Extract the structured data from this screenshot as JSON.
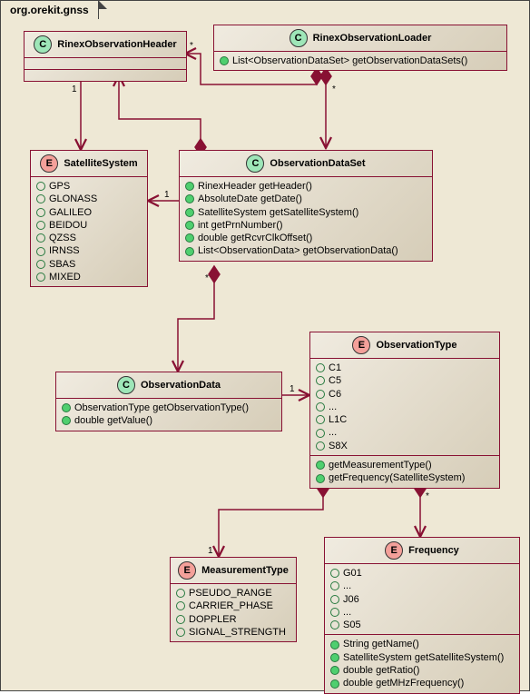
{
  "package": {
    "name": "org.orekit.gnss"
  },
  "nodes": {
    "rinexHeader": {
      "stereo": "C",
      "name": "RinexObservationHeader",
      "comp1": [],
      "comp2": []
    },
    "rinexLoader": {
      "stereo": "C",
      "name": "RinexObservationLoader",
      "methods": [
        "List<ObservationDataSet> getObservationDataSets()"
      ]
    },
    "satSystem": {
      "stereo": "E",
      "name": "SatelliteSystem",
      "values": [
        "GPS",
        "GLONASS",
        "GALILEO",
        "BEIDOU",
        "QZSS",
        "IRNSS",
        "SBAS",
        "MIXED"
      ]
    },
    "obsDataSet": {
      "stereo": "C",
      "name": "ObservationDataSet",
      "methods": [
        "RinexHeader getHeader()",
        "AbsoluteDate getDate()",
        "SatelliteSystem getSatelliteSystem()",
        "int getPrnNumber()",
        "double getRcvrClkOffset()",
        "List<ObservationData> getObservationData()"
      ]
    },
    "obsData": {
      "stereo": "C",
      "name": "ObservationData",
      "methods": [
        "ObservationType getObservationType()",
        "double getValue()"
      ]
    },
    "obsType": {
      "stereo": "E",
      "name": "ObservationType",
      "values": [
        "C1",
        "C5",
        "C6",
        "...",
        "L1C",
        "...",
        "S8X"
      ],
      "methods": [
        "getMeasurementType()",
        "getFrequency(SatelliteSystem)"
      ]
    },
    "measType": {
      "stereo": "E",
      "name": "MeasurementType",
      "values": [
        "PSEUDO_RANGE",
        "CARRIER_PHASE",
        "DOPPLER",
        "SIGNAL_STRENGTH"
      ]
    },
    "frequency": {
      "stereo": "E",
      "name": "Frequency",
      "values": [
        "G01",
        "...",
        "J06",
        "...",
        "S05"
      ],
      "methods": [
        "String getName()",
        "SatelliteSystem getSatelliteSystem()",
        "double getRatio()",
        "double getMHzFrequency()"
      ]
    }
  },
  "mults": {
    "loaderToHeader_star": "*",
    "loaderToSet_star": "*",
    "headerToSat_one": "1",
    "setToSat_one": "1",
    "setToData_star": "*",
    "dataToType_one": "1",
    "typeToMeas_one": "1",
    "typeToFreq_star": "*"
  }
}
